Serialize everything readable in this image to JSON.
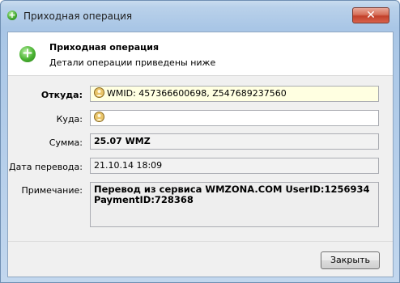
{
  "window": {
    "title": "Приходная операция",
    "close_symbol": "✕"
  },
  "header": {
    "title": "Приходная операция",
    "subtitle": "Детали операции приведены ниже",
    "icon": "plus-icon"
  },
  "form": {
    "from_label": "Откуда:",
    "from_value": "WMID: 457366600698, Z547689237560",
    "to_label": "Куда:",
    "to_value": "",
    "amount_label": "Сумма:",
    "amount_value": "25.07 WMZ",
    "date_label": "Дата перевода:",
    "date_value": "21.10.14 18:09",
    "note_label": "Примечание:",
    "note_value": "Перевод из сервиса WMZONA.COM UserID:1256934\nPaymentID:728368"
  },
  "footer": {
    "close_label": "Закрыть"
  },
  "colors": {
    "accent_green": "#3ea52c",
    "from_field_bg": "#ffffe1",
    "titlebar_blue": "#b9d1ea",
    "close_red": "#c2402a"
  }
}
